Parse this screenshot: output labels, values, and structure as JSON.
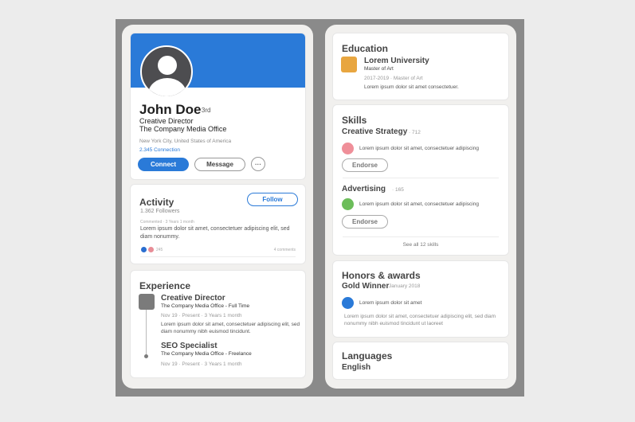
{
  "profile": {
    "name": "John Doe",
    "degree": "· 3rd",
    "title": "Creative Director",
    "company": "The Company Media Office",
    "location": "New York City, United States of America",
    "connections": "2.345 Connection",
    "connect_label": "Connect",
    "message_label": "Message",
    "more_label": "···"
  },
  "activity": {
    "title": "Activity",
    "followers": "1.362 Followers",
    "follow_label": "Follow",
    "meta": "Commented · 3 Years 1 month",
    "text": "Lorem ipsum dolor sit amet, consectetuer adipiscing elit, sed diam nonummy.",
    "reactions": "245",
    "comments": "4 comments"
  },
  "experience": {
    "title": "Experience",
    "jobs": [
      {
        "title": "Creative Director",
        "company": "The Company Media Office - Full Time",
        "date": "Nov 19 · Present · 3 Years 1 month",
        "desc": "Lorem ipsum dolor sit amet, consectetuer adipiscing elit, sed diam nonummy nibh euismod tincidunt."
      },
      {
        "title": "SEO Specialist",
        "company": "The Company Media Office - Freelance",
        "date": "Nov 19 · Present · 3 Years 1 month"
      }
    ]
  },
  "education": {
    "title": "Education",
    "school": "Lorem University",
    "degree": "Master of Art",
    "years": "2017-2019 · Master of Art",
    "desc": "Lorem ipsum dolor sit amet consectetuer."
  },
  "skills": {
    "title": "Skills",
    "items": [
      {
        "name": "Creative Strategy",
        "count": "· 712",
        "desc": "Lorem ipsum dolor sit amet, consectetuer adipiscing",
        "color": "#ef8f99",
        "endorse_label": "Endorse"
      },
      {
        "name": "Advertising",
        "count": "· 165",
        "desc": "Lorem ipsum dolor sit amet, consectetuer adipiscing",
        "color": "#6cbd5a",
        "endorse_label": "Endorse"
      }
    ],
    "see_all": "See all 12 skills"
  },
  "honors": {
    "title": "Honors & awards",
    "name": "Gold Winner",
    "date": "· January 2018",
    "sub": "Lorem ipsum dolor sit amet",
    "desc": "Lorem ipsum dolor sit amet, consectetuer adipiscing elit, sed diam nonummy nibh euismod tincidunt ut laoreet"
  },
  "languages": {
    "title": "Languages",
    "items": [
      "English"
    ]
  }
}
